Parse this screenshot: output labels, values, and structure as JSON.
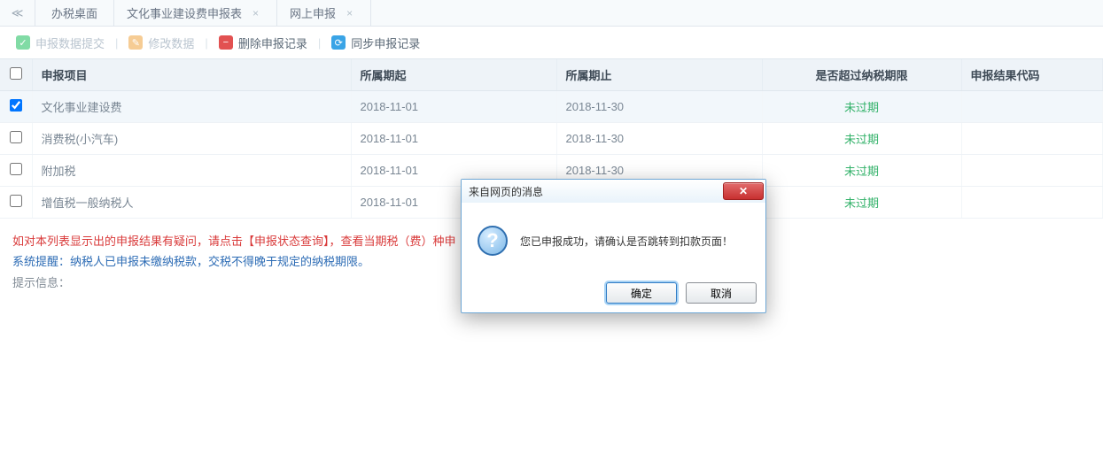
{
  "tabs": {
    "back_icon": "≪",
    "items": [
      {
        "label": "办税桌面",
        "closable": false
      },
      {
        "label": "文化事业建设费申报表",
        "closable": true
      },
      {
        "label": "网上申报",
        "closable": true
      }
    ]
  },
  "toolbar": {
    "submit": {
      "label": "申报数据提交",
      "enabled": false,
      "icon": "✓",
      "color": "green"
    },
    "modify": {
      "label": "修改数据",
      "enabled": false,
      "icon": "✎",
      "color": "orange"
    },
    "delete": {
      "label": "删除申报记录",
      "enabled": true,
      "icon": "−",
      "color": "red"
    },
    "sync": {
      "label": "同步申报记录",
      "enabled": true,
      "icon": "⟳",
      "color": "blue"
    }
  },
  "table": {
    "headers": {
      "project": "申报项目",
      "start": "所属期起",
      "end": "所属期止",
      "overdue": "是否超过纳税期限",
      "result": "申报结果代码"
    },
    "rows": [
      {
        "checked": true,
        "project": "文化事业建设费",
        "start": "2018-11-01",
        "end": "2018-11-30",
        "overdue": "未过期",
        "result": ""
      },
      {
        "checked": false,
        "project": "消费税(小汽车)",
        "start": "2018-11-01",
        "end": "2018-11-30",
        "overdue": "未过期",
        "result": ""
      },
      {
        "checked": false,
        "project": "附加税",
        "start": "2018-11-01",
        "end": "2018-11-30",
        "overdue": "未过期",
        "result": ""
      },
      {
        "checked": false,
        "project": "增值税一般纳税人",
        "start": "2018-11-01",
        "end": "",
        "overdue": "未过期",
        "result": ""
      }
    ]
  },
  "notes": {
    "line1": "如对本列表显示出的申报结果有疑问，请点击【申报状态查询】，查看当期税（费）种申",
    "line2": "系统提醒：纳税人已申报未缴纳税款，交税不得晚于规定的纳税期限。",
    "line3": "提示信息："
  },
  "dialog": {
    "title": "来自网页的消息",
    "message": "您已申报成功，请确认是否跳转到扣款页面！",
    "ok": "确定",
    "cancel": "取消"
  }
}
